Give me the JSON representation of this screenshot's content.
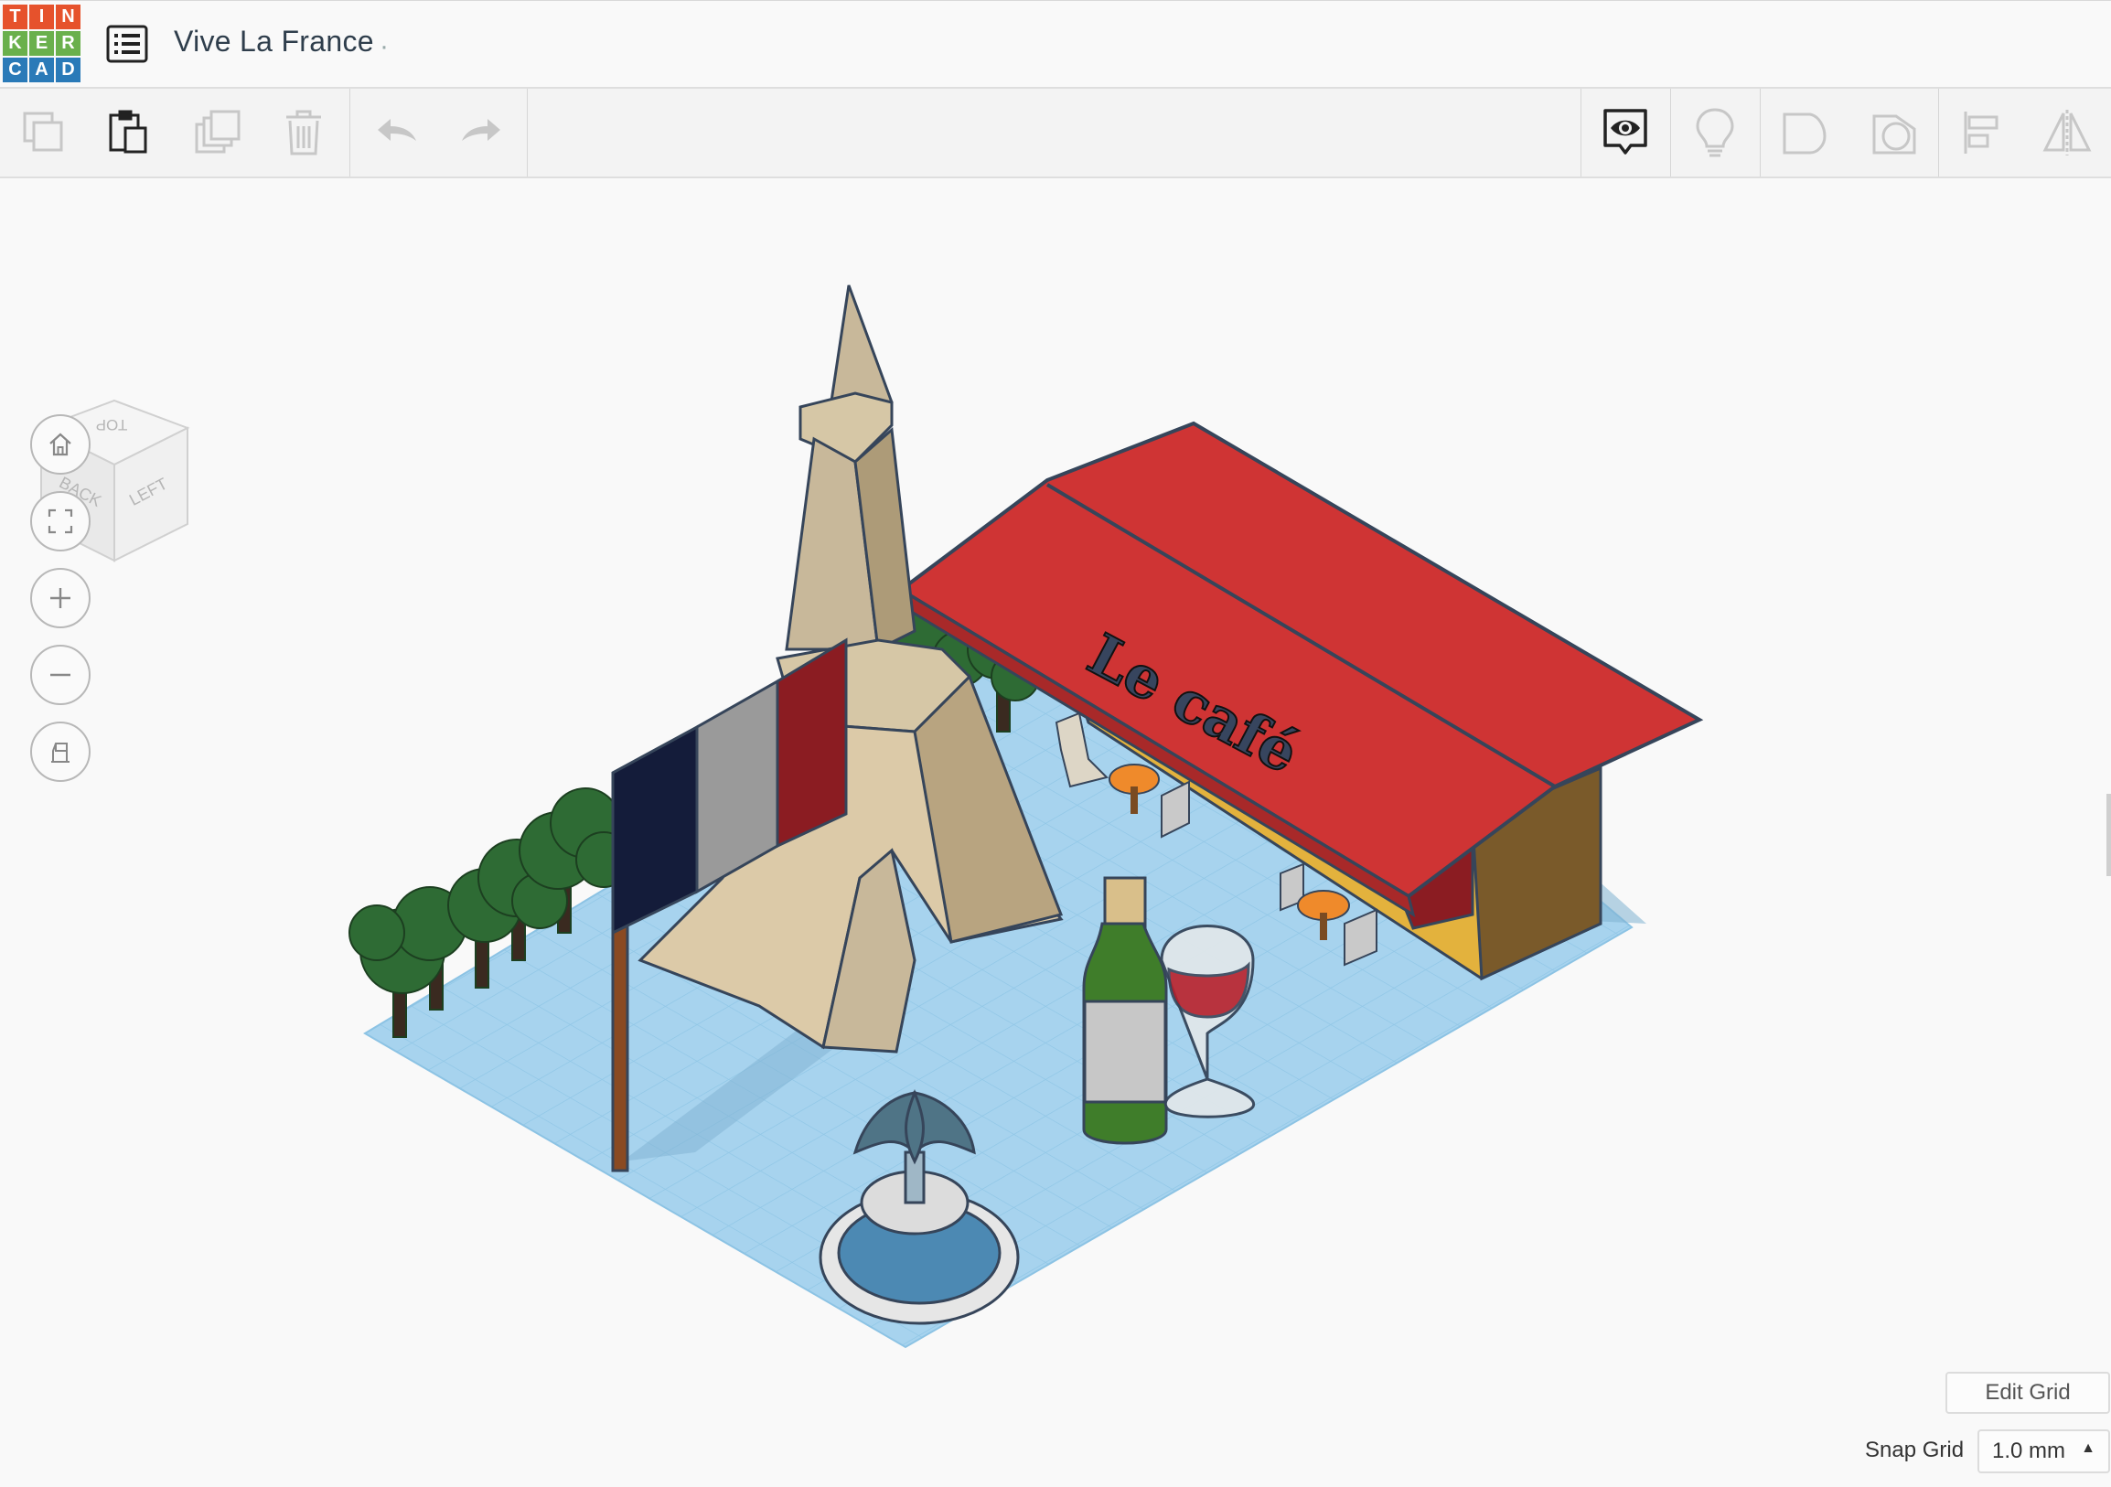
{
  "app": {
    "logo_letters": [
      "T",
      "I",
      "N",
      "K",
      "E",
      "R",
      "C",
      "A",
      "D"
    ],
    "logo_colors": [
      "#e6522c",
      "#e6522c",
      "#e6522c",
      "#6ab04c",
      "#6ab04c",
      "#6ab04c",
      "#2a7ab8",
      "#2a7ab8",
      "#2a7ab8"
    ],
    "document_title": "Vive La France",
    "document_icon": "list-icon"
  },
  "toolbar": {
    "left_tools": [
      {
        "name": "copy",
        "icon": "copy-icon",
        "enabled": false
      },
      {
        "name": "paste",
        "icon": "paste-icon",
        "enabled": true
      },
      {
        "name": "duplicate",
        "icon": "duplicate-icon",
        "enabled": false
      },
      {
        "name": "delete",
        "icon": "trash-icon",
        "enabled": false
      },
      {
        "name": "undo",
        "icon": "undo-icon",
        "enabled": false
      },
      {
        "name": "redo",
        "icon": "redo-icon",
        "enabled": false
      }
    ],
    "right_tools": [
      {
        "name": "notes",
        "icon": "eye-speech-icon",
        "enabled": true
      },
      {
        "name": "light",
        "icon": "lightbulb-icon",
        "enabled": false
      },
      {
        "name": "shape",
        "icon": "shape-icon",
        "enabled": false
      },
      {
        "name": "hole",
        "icon": "hole-icon",
        "enabled": false
      },
      {
        "name": "align",
        "icon": "align-icon",
        "enabled": false
      },
      {
        "name": "mirror",
        "icon": "mirror-icon",
        "enabled": false
      }
    ]
  },
  "viewcube": {
    "top_label": "TOP",
    "back_label": "BACK",
    "left_label": "LEFT"
  },
  "nav": [
    "home-icon",
    "fit-view-icon",
    "zoom-in-icon",
    "zoom-out-icon",
    "ortho-view-icon"
  ],
  "scene": {
    "cafe_sign": "Le café",
    "flag_colors": [
      "#141c3a",
      "#9a9a9a",
      "#8b1c22"
    ],
    "roof_color": "#cf3434",
    "grid_color": "#a7d3ee"
  },
  "grid_controls": {
    "edit_grid_label": "Edit Grid",
    "snap_label": "Snap Grid",
    "snap_value": "1.0 mm"
  }
}
